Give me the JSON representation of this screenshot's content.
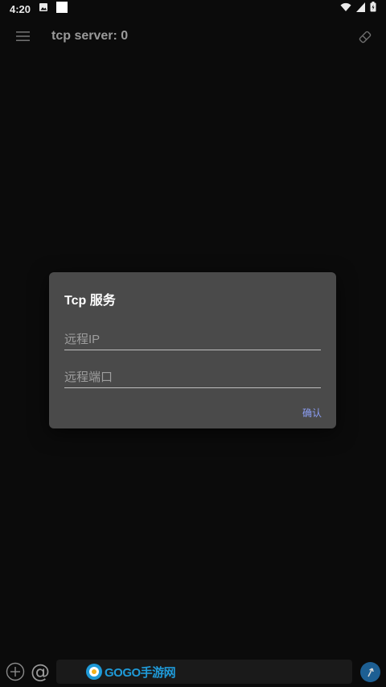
{
  "status_bar": {
    "time": "4:20"
  },
  "toolbar": {
    "title": "tcp server: 0"
  },
  "dialog": {
    "title": "Tcp 服务",
    "ip_placeholder": "远程IP",
    "ip_value": "",
    "port_placeholder": "远程端口",
    "port_value": "",
    "confirm_label": "确认"
  },
  "bottom_bar": {
    "at_symbol": "@",
    "watermark": "GOGO手游网"
  },
  "colors": {
    "background": "#0b0b0b",
    "dialog_bg": "#4a4a4a",
    "accent": "#8c9ff5",
    "send_button": "#1d5f93"
  }
}
